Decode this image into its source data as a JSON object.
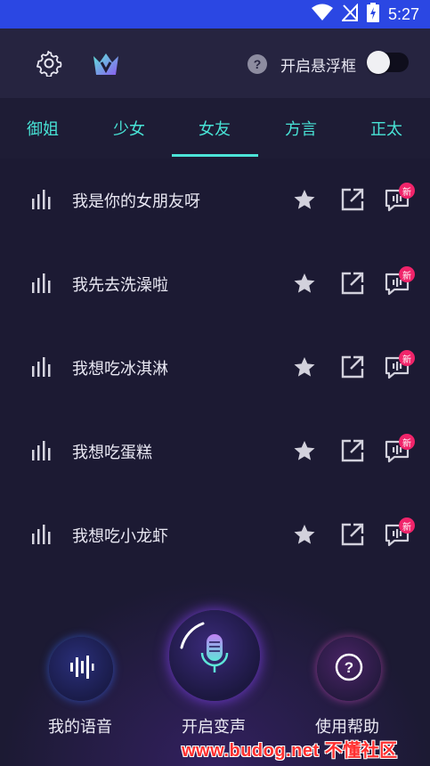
{
  "status_bar": {
    "time": "5:27"
  },
  "top_bar": {
    "float_window_label": "开启悬浮框",
    "float_window_enabled": false
  },
  "tabs": [
    {
      "label": "御姐",
      "selected": false
    },
    {
      "label": "少女",
      "selected": false
    },
    {
      "label": "女友",
      "selected": true
    },
    {
      "label": "方言",
      "selected": false
    },
    {
      "label": "正太",
      "selected": false
    }
  ],
  "voices": [
    {
      "title": "我是你的女朋友呀",
      "badge": "新"
    },
    {
      "title": "我先去洗澡啦",
      "badge": "新"
    },
    {
      "title": "我想吃冰淇淋",
      "badge": "新"
    },
    {
      "title": "我想吃蛋糕",
      "badge": "新"
    },
    {
      "title": "我想吃小龙虾",
      "badge": "新"
    }
  ],
  "bottom_nav": {
    "my_voice": "我的语音",
    "start_voice_change": "开启变声",
    "help": "使用帮助"
  },
  "watermark": "www.budog.net 不懂社区",
  "colors": {
    "accent": "#4ce4d8",
    "badge": "#f0246a",
    "status_bar": "#2b47e3"
  }
}
